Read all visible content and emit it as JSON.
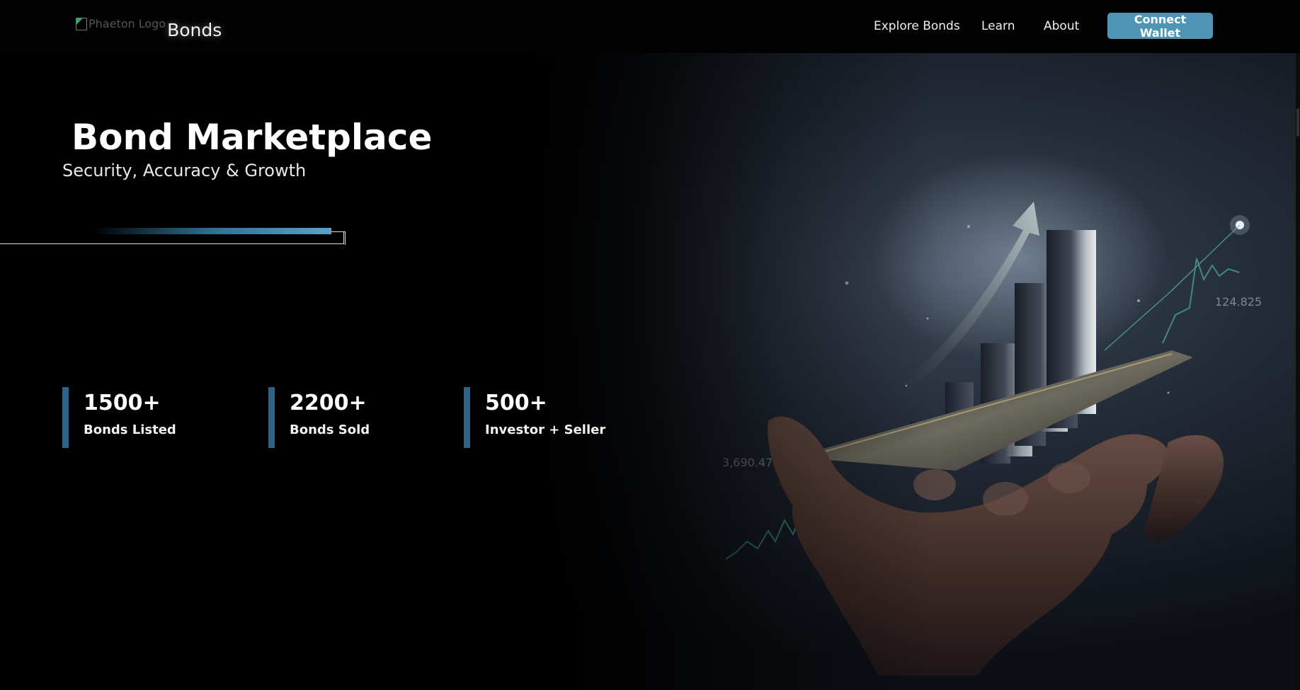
{
  "header": {
    "logo_alt": "Phaeton Logo",
    "brand_name": "Bonds",
    "nav": [
      {
        "label": "Explore Bonds"
      },
      {
        "label": "Learn"
      },
      {
        "label": "About"
      }
    ],
    "connect_label": "Connect Wallet"
  },
  "hero": {
    "title": "Bond Marketplace",
    "subtitle": "Security, Accuracy & Growth",
    "image": {
      "label_left": "3,690.47",
      "label_right": "124.825"
    }
  },
  "stats": [
    {
      "value": "1500+",
      "label": "Bonds Listed"
    },
    {
      "value": "2200+",
      "label": "Bonds Sold"
    },
    {
      "value": "500+",
      "label": "Investor + Seller"
    }
  ],
  "colors": {
    "accent": "#4f95b6",
    "stat_bar": "#2b6488",
    "background": "#000000"
  }
}
